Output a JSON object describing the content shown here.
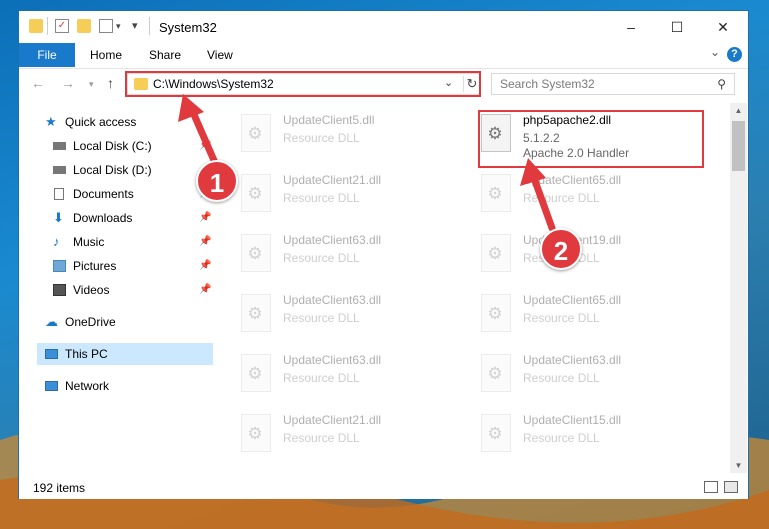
{
  "window": {
    "title": "System32",
    "controls": {
      "minimize": "–",
      "maximize": "☐",
      "close": "✕"
    }
  },
  "ribbon": {
    "tabs": [
      "File",
      "Home",
      "Share",
      "View"
    ],
    "help": "?"
  },
  "address": {
    "path": "C:\\Windows\\System32",
    "dropdown": "⌄",
    "refresh": "↻"
  },
  "search": {
    "placeholder": "Search System32",
    "icon": "search-icon"
  },
  "sidebar": {
    "items": [
      {
        "label": "Quick access",
        "icon": "star-icon",
        "pinned": false
      },
      {
        "label": "Local Disk (C:)",
        "icon": "drive-icon",
        "pinned": true
      },
      {
        "label": "Local Disk (D:)",
        "icon": "drive-icon",
        "pinned": false
      },
      {
        "label": "Documents",
        "icon": "documents-icon",
        "pinned": true
      },
      {
        "label": "Downloads",
        "icon": "downloads-icon",
        "pinned": true
      },
      {
        "label": "Music",
        "icon": "music-icon",
        "pinned": true
      },
      {
        "label": "Pictures",
        "icon": "pictures-icon",
        "pinned": true
      },
      {
        "label": "Videos",
        "icon": "videos-icon",
        "pinned": true
      },
      {
        "label": "OneDrive",
        "icon": "onedrive-icon",
        "pinned": false
      },
      {
        "label": "This PC",
        "icon": "computer-icon",
        "selected": true
      },
      {
        "label": "Network",
        "icon": "network-icon",
        "pinned": false
      }
    ]
  },
  "files": {
    "highlighted": {
      "name": "php5apache2.dll",
      "version": "5.1.2.2",
      "description": "Apache 2.0 Handler"
    },
    "left_column": [
      {
        "name": "UpdateClient5.dll",
        "type": "Resource DLL"
      },
      {
        "name": "UpdateClient21.dll",
        "type": "Resource DLL"
      },
      {
        "name": "UpdateClient63.dll",
        "type": "Resource DLL"
      },
      {
        "name": "UpdateClient63.dll",
        "type": "Resource DLL"
      },
      {
        "name": "UpdateClient63.dll",
        "type": "Resource DLL"
      },
      {
        "name": "UpdateClient21.dll",
        "type": "Resource DLL"
      }
    ],
    "right_column": [
      {
        "name": "UpdateClient65.dll",
        "type": "Resource DLL"
      },
      {
        "name": "UpdateClient19.dll",
        "type": "Resource DLL"
      },
      {
        "name": "UpdateClient65.dll",
        "type": "Resource DLL"
      },
      {
        "name": "UpdateClient63.dll",
        "type": "Resource DLL"
      },
      {
        "name": "UpdateClient15.dll",
        "type": "Resource DLL"
      }
    ]
  },
  "status": {
    "item_count": "192 items"
  },
  "annotations": {
    "step1": "1",
    "step2": "2",
    "color": "#e0393e"
  }
}
